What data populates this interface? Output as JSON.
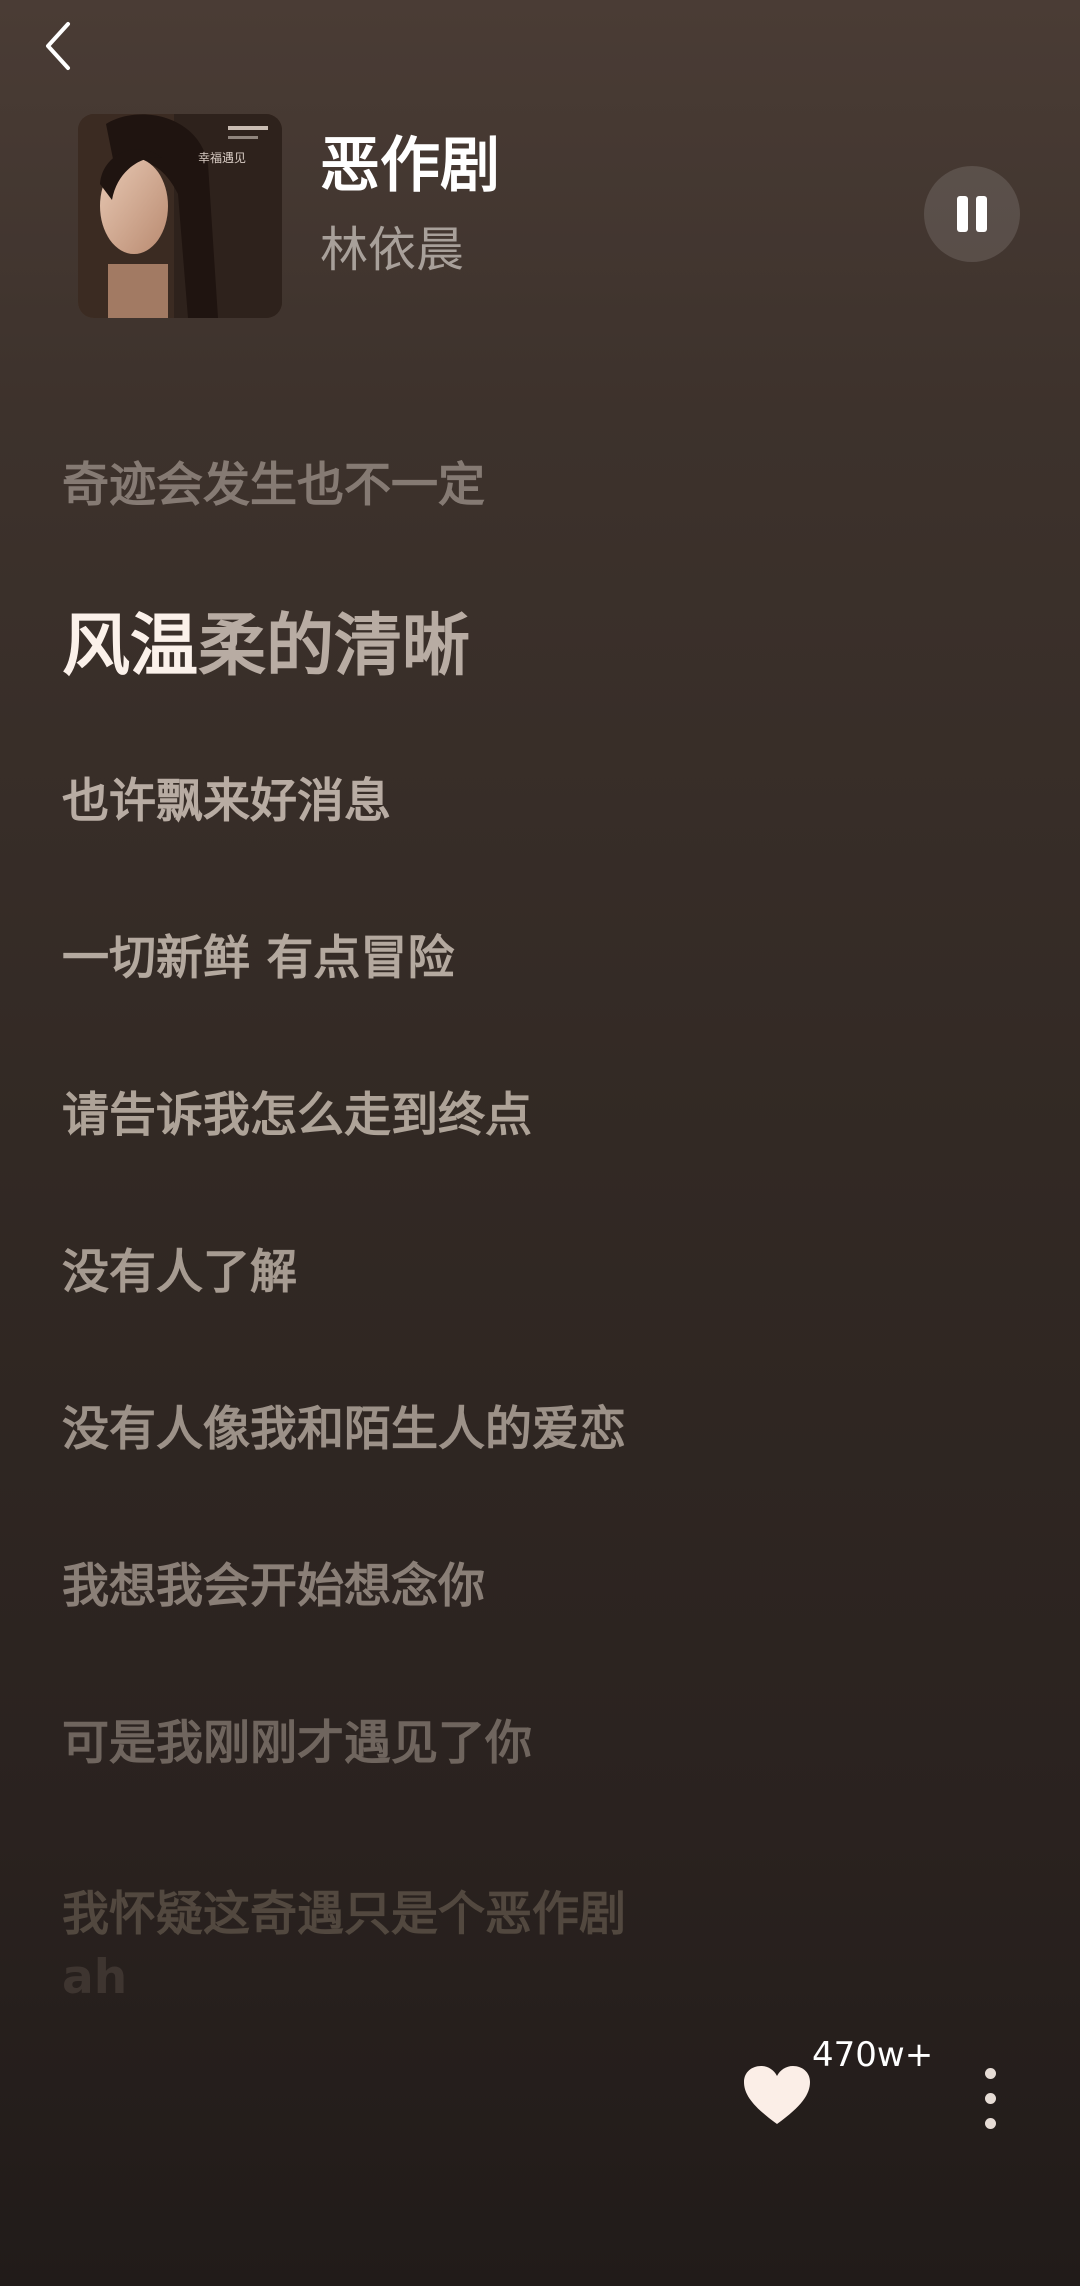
{
  "header": {
    "back_icon": "chevron-left-icon"
  },
  "now_playing": {
    "title": "恶作剧",
    "artist": "林依晨",
    "pause_icon": "pause-icon"
  },
  "lyrics": [
    {
      "text": "奇迹会发生也不一定",
      "state": "past"
    },
    {
      "text_done": "风温",
      "text_todo": "柔的清晰",
      "state": "current"
    },
    {
      "text": "也许飘来好消息",
      "state": "upcoming"
    },
    {
      "text": "一切新鲜 有点冒险",
      "state": "upcoming"
    },
    {
      "text": "请告诉我怎么走到终点",
      "state": "upcoming"
    },
    {
      "text": "没有人了解",
      "state": "upcoming"
    },
    {
      "text": "没有人像我和陌生人的爱恋",
      "state": "upcoming"
    },
    {
      "text": "我想我会开始想念你",
      "state": "upcoming"
    },
    {
      "text": "可是我刚刚才遇见了你",
      "state": "upcoming"
    },
    {
      "text": "我怀疑这奇遇只是个恶作剧",
      "state": "upcoming"
    },
    {
      "text": "ah",
      "state": "upcoming"
    }
  ],
  "actions": {
    "like_icon": "heart-icon",
    "like_count": "470w+",
    "more_icon": "more-vertical-icon"
  },
  "colors": {
    "lyric_done": "#fbf1ea",
    "lyric_todo": "#b8aca3"
  }
}
